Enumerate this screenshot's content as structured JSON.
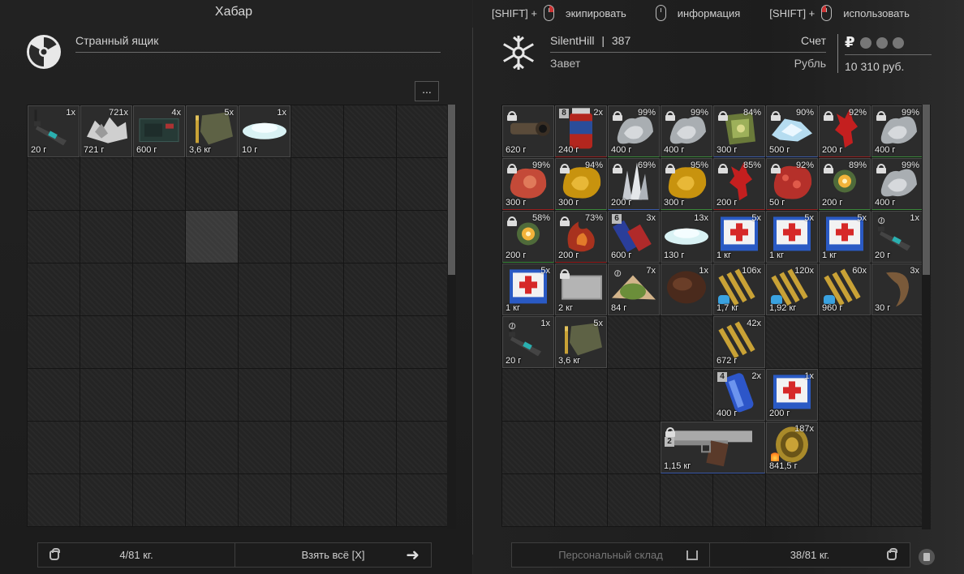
{
  "left_panel": {
    "title": "Хабар",
    "container_name": "Странный ящик",
    "more_label": "...",
    "footer_weight": "4/81 кг.",
    "take_all_label": "Взять всё [X]"
  },
  "hints": [
    {
      "mod": "[SHIFT] +",
      "label": "экипировать"
    },
    {
      "mod": "",
      "label": "информация"
    },
    {
      "mod": "[SHIFT] +",
      "label": "использовать"
    }
  ],
  "right_panel": {
    "player_name": "SilentHill",
    "player_level": "387",
    "player_sep": "|",
    "faction": "Завет",
    "account_label": "Счет",
    "currency_label": "Рубль",
    "currency_symbol": "₽",
    "balance": "10 310 руб.",
    "stash_label": "Персональный склад",
    "footer_weight": "38/81 кг."
  },
  "left_items": [
    {
      "count": "1x",
      "weight": "20 г",
      "icon": "detector-icon"
    },
    {
      "count": "721x",
      "weight": "721 г",
      "icon": "scrap-metal-icon"
    },
    {
      "count": "4x",
      "weight": "600 г",
      "icon": "device-case-icon"
    },
    {
      "count": "5x",
      "weight": "3,6 кг",
      "icon": "ammo-bag-icon"
    },
    {
      "count": "1x",
      "weight": "10 г",
      "icon": "crystal-dust-icon"
    }
  ],
  "right_items": [
    {
      "count": "",
      "weight": "620 г",
      "icon": "scope-icon",
      "lock": true
    },
    {
      "count": "2x",
      "weight": "240 г",
      "icon": "red-jar-icon",
      "num": "8"
    },
    {
      "count": "99%",
      "weight": "400 г",
      "icon": "silver-artifact-icon",
      "lock": true
    },
    {
      "count": "99%",
      "weight": "400 г",
      "icon": "silver-artifact-icon",
      "lock": true
    },
    {
      "count": "84%",
      "weight": "300 г",
      "icon": "moss-artifact-icon",
      "lock": true
    },
    {
      "count": "90%",
      "weight": "500 г",
      "icon": "ice-artifact-icon",
      "lock": true
    },
    {
      "count": "92%",
      "weight": "200 г",
      "icon": "red-coral-icon",
      "lock": true
    },
    {
      "count": "99%",
      "weight": "400 г",
      "icon": "silver-artifact-icon",
      "lock": true
    },
    {
      "count": "99%",
      "weight": "300 г",
      "icon": "red-artifact-icon",
      "lock": true
    },
    {
      "count": "94%",
      "weight": "300 г",
      "icon": "gold-artifact-icon",
      "lock": true
    },
    {
      "count": "69%",
      "weight": "200 г",
      "icon": "crystal-artifact-icon",
      "lock": true
    },
    {
      "count": "95%",
      "weight": "300 г",
      "icon": "gold-artifact-icon",
      "lock": true
    },
    {
      "count": "85%",
      "weight": "200 г",
      "icon": "red-coral-icon",
      "lock": true
    },
    {
      "count": "92%",
      "weight": "50 г",
      "icon": "red-meat-artifact-icon",
      "lock": true
    },
    {
      "count": "89%",
      "weight": "200 г",
      "icon": "spark-artifact-icon",
      "lock": true
    },
    {
      "count": "99%",
      "weight": "400 г",
      "icon": "silver-artifact-icon",
      "lock": true
    },
    {
      "count": "58%",
      "weight": "200 г",
      "icon": "spark-artifact-icon",
      "lock": true
    },
    {
      "count": "73%",
      "weight": "200 г",
      "icon": "flame-artifact-icon",
      "lock": true
    },
    {
      "count": "3x",
      "weight": "600 г",
      "icon": "battery-icon",
      "num": "6"
    },
    {
      "count": "13x",
      "weight": "130 г",
      "icon": "crystal-dust-icon"
    },
    {
      "count": "5x",
      "weight": "1 кг",
      "icon": "medkit-icon"
    },
    {
      "count": "5x",
      "weight": "1 кг",
      "icon": "medkit-icon"
    },
    {
      "count": "5x",
      "weight": "1 кг",
      "icon": "medkit-icon"
    },
    {
      "count": "1x",
      "weight": "20 г",
      "icon": "detector-icon",
      "link": true
    },
    {
      "count": "5x",
      "weight": "1 кг",
      "icon": "medkit-icon"
    },
    {
      "count": "",
      "weight": "2 кг",
      "icon": "grey-plate-icon",
      "lock": true
    },
    {
      "count": "7x",
      "weight": "84 г",
      "icon": "food-icon",
      "link": true
    },
    {
      "count": "1x",
      "weight": "",
      "icon": "fur-icon"
    },
    {
      "count": "106x",
      "weight": "1,7 кг",
      "icon": "rifle-ammo-icon",
      "cat": true
    },
    {
      "count": "120x",
      "weight": "1,92 кг",
      "icon": "rifle-ammo-icon",
      "cat": true
    },
    {
      "count": "60x",
      "weight": "960 г",
      "icon": "rifle-ammo-icon",
      "cat": true
    },
    {
      "count": "3x",
      "weight": "30 г",
      "icon": "claw-icon"
    },
    {
      "count": "1x",
      "weight": "20 г",
      "icon": "detector-icon",
      "link": true
    },
    {
      "count": "5x",
      "weight": "3,6 кг",
      "icon": "ammo-bag-icon"
    },
    {
      "count": "42x",
      "weight": "672 г",
      "icon": "rifle-ammo-icon"
    },
    {
      "count": "2x",
      "weight": "400 г",
      "icon": "blue-canister-icon",
      "num": "4"
    },
    {
      "count": "1x",
      "weight": "200 г",
      "icon": "medkit-icon"
    },
    {
      "count": "",
      "weight": "1,15 кг",
      "icon": "pistol-icon",
      "lock": true,
      "num2": "2"
    },
    {
      "count": "187x",
      "weight": "841,5 г",
      "icon": "coiled-ammo-icon",
      "fire": true
    }
  ]
}
